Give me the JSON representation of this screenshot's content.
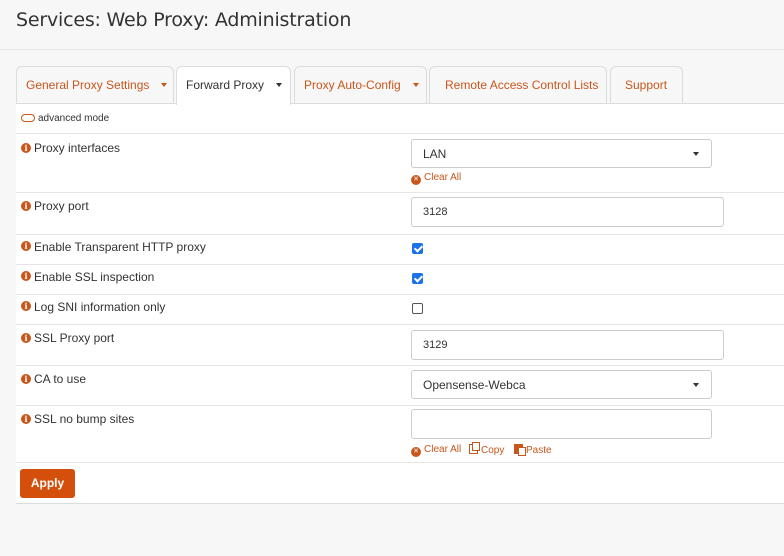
{
  "page_title": "Services: Web Proxy: Administration",
  "tabs": [
    {
      "label": "General Proxy Settings",
      "has_dropdown": true,
      "active": false
    },
    {
      "label": "Forward Proxy",
      "has_dropdown": true,
      "active": true
    },
    {
      "label": "Proxy Auto-Config",
      "has_dropdown": true,
      "active": false
    },
    {
      "label": "Remote Access Control Lists",
      "has_dropdown": false,
      "active": false
    },
    {
      "label": "Support",
      "has_dropdown": false,
      "active": false
    }
  ],
  "advanced_mode_label": "advanced mode",
  "fields": {
    "proxy_interfaces": {
      "label": "Proxy interfaces",
      "value": "LAN",
      "clear_all": "Clear All"
    },
    "proxy_port": {
      "label": "Proxy port",
      "value": "3128"
    },
    "transparent_http": {
      "label": "Enable Transparent HTTP proxy",
      "checked": true
    },
    "ssl_inspection": {
      "label": "Enable SSL inspection",
      "checked": true
    },
    "log_sni": {
      "label": "Log SNI information only",
      "checked": false
    },
    "ssl_proxy_port": {
      "label": "SSL Proxy port",
      "value": "3129"
    },
    "ca_to_use": {
      "label": "CA to use",
      "value": "Opensense-Webca"
    },
    "ssl_no_bump": {
      "label": "SSL no bump sites",
      "value": "",
      "clear_all": "Clear All",
      "copy": "Copy",
      "paste": "Paste"
    }
  },
  "apply_label": "Apply",
  "colors": {
    "accent": "#c8561b",
    "apply_button": "#d44f0b",
    "checkbox": "#1a73e8"
  }
}
